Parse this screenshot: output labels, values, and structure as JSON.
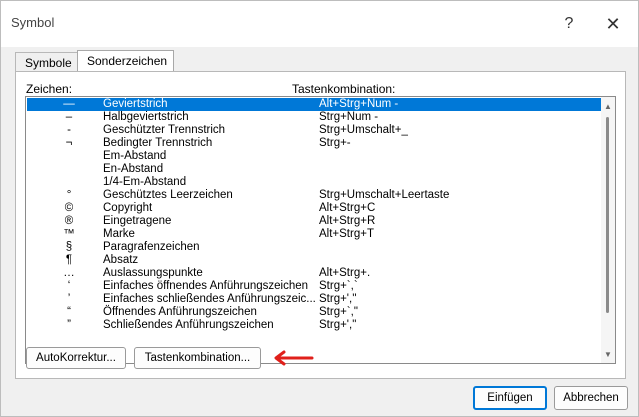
{
  "window": {
    "title": "Symbol",
    "help_label": "?",
    "close_label": "✕"
  },
  "tabs": [
    {
      "label": "Symbole"
    },
    {
      "label": "Sonderzeichen"
    }
  ],
  "list": {
    "header_char": "Zeichen:",
    "header_keys": "Tastenkombination:",
    "rows": [
      {
        "char": "—",
        "name": "Geviertstrich",
        "keys": "Alt+Strg+Num -"
      },
      {
        "char": "–",
        "name": "Halbgeviertstrich",
        "keys": "Strg+Num -"
      },
      {
        "char": "-",
        "name": "Geschützter Trennstrich",
        "keys": "Strg+Umschalt+_"
      },
      {
        "char": "¬",
        "name": "Bedingter Trennstrich",
        "keys": "Strg+-"
      },
      {
        "char": "",
        "name": "Em-Abstand",
        "keys": ""
      },
      {
        "char": "",
        "name": "En-Abstand",
        "keys": ""
      },
      {
        "char": "",
        "name": "1/4-Em-Abstand",
        "keys": ""
      },
      {
        "char": "°",
        "name": "Geschütztes Leerzeichen",
        "keys": "Strg+Umschalt+Leertaste"
      },
      {
        "char": "©",
        "name": "Copyright",
        "keys": "Alt+Strg+C"
      },
      {
        "char": "®",
        "name": "Eingetragene",
        "keys": "Alt+Strg+R"
      },
      {
        "char": "™",
        "name": "Marke",
        "keys": "Alt+Strg+T"
      },
      {
        "char": "§",
        "name": "Paragrafenzeichen",
        "keys": ""
      },
      {
        "char": "¶",
        "name": "Absatz",
        "keys": ""
      },
      {
        "char": "…",
        "name": "Auslassungspunkte",
        "keys": "Alt+Strg+."
      },
      {
        "char": "‘",
        "name": "Einfaches öffnendes Anführungszeichen",
        "keys": "Strg+`,`"
      },
      {
        "char": "’",
        "name": "Einfaches schließendes Anführungszeic...",
        "keys": "Strg+',''"
      },
      {
        "char": "“",
        "name": "Öffnendes Anführungszeichen",
        "keys": "Strg+`,\""
      },
      {
        "char": "”",
        "name": "Schließendes Anführungszeichen",
        "keys": "Strg+',\""
      }
    ],
    "selected_index": 0
  },
  "buttons": {
    "autokorrektur": "AutoKorrektur...",
    "tastenkombination": "Tastenkombination...",
    "einfuegen": "Einfügen",
    "abbrechen": "Abbrechen"
  },
  "colors": {
    "selection": "#0078d7",
    "arrow": "#e0201b"
  }
}
